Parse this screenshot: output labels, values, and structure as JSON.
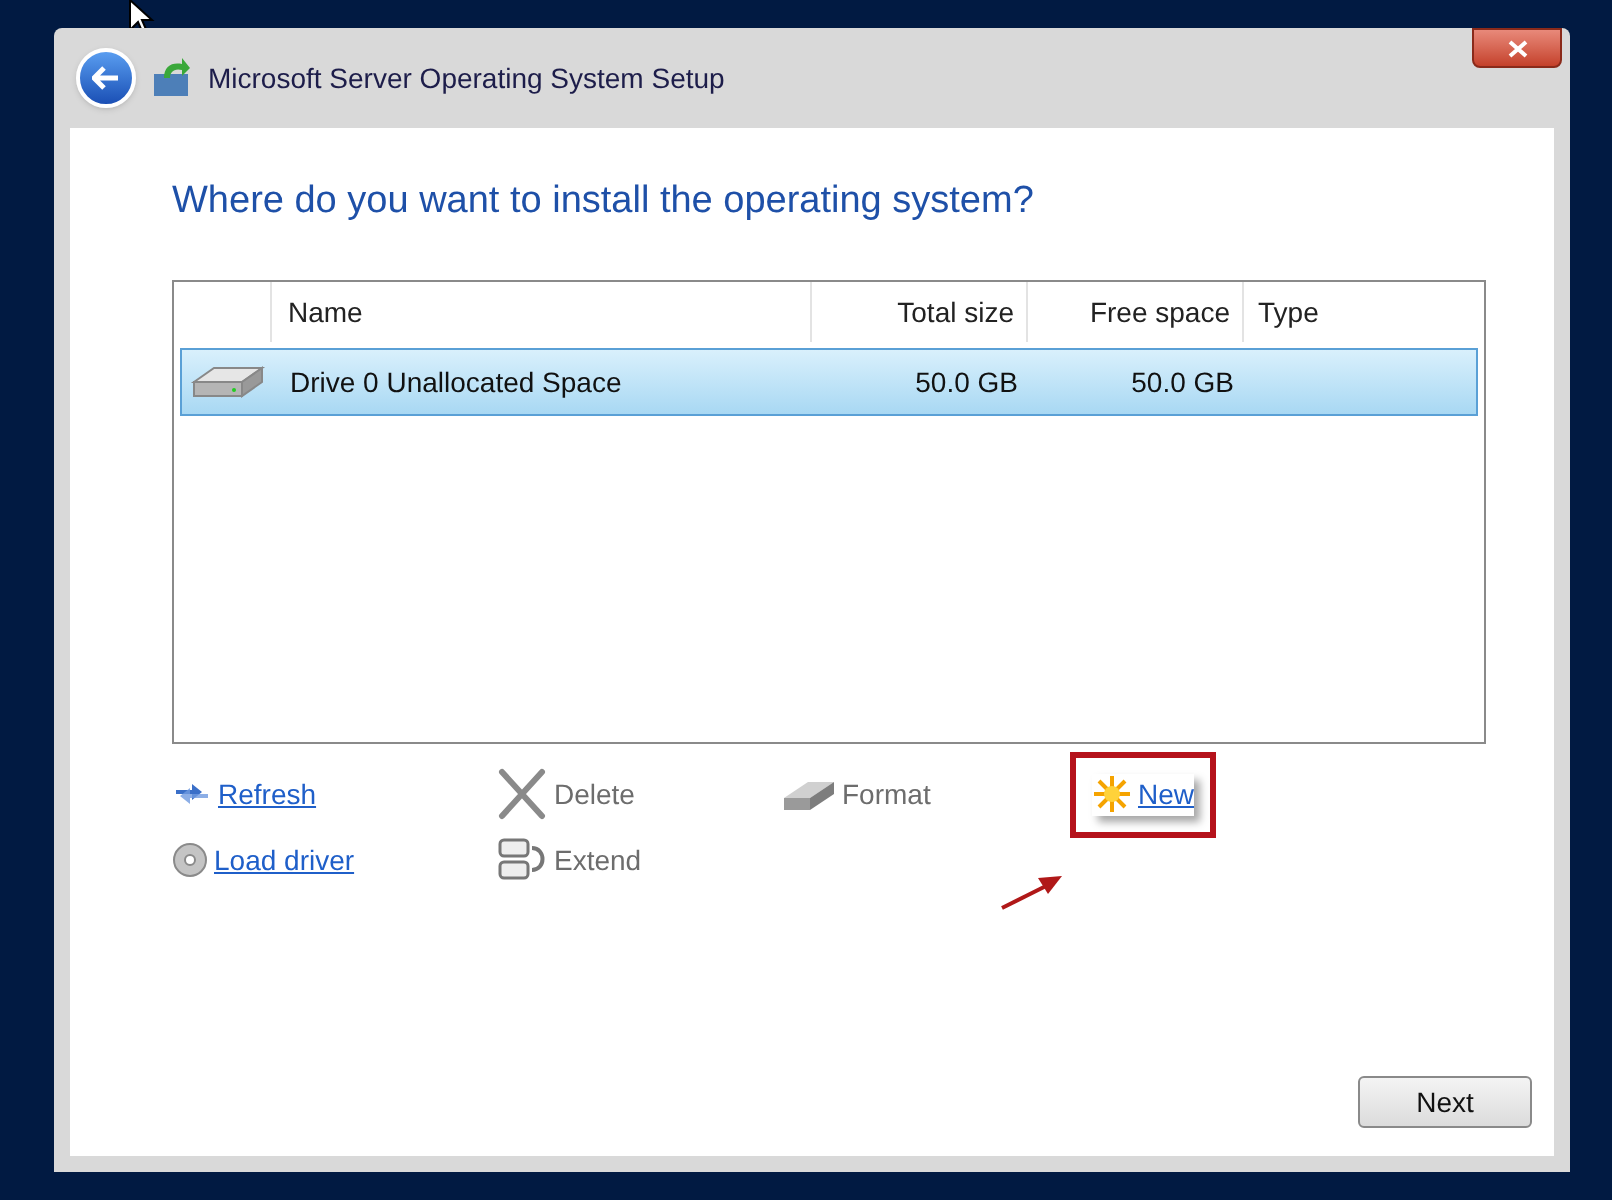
{
  "window": {
    "title": "Microsoft Server Operating System Setup"
  },
  "heading": "Where do you want to install the operating system?",
  "table": {
    "columns": [
      "Name",
      "Total size",
      "Free space",
      "Type"
    ],
    "rows": [
      {
        "name": "Drive 0 Unallocated Space",
        "total_size": "50.0 GB",
        "free_space": "50.0 GB",
        "selected": true
      }
    ]
  },
  "actions": [
    {
      "kind": "refresh",
      "label": "Refresh",
      "disabled": false,
      "highlighted": false
    },
    {
      "kind": "delete",
      "label": "Delete",
      "disabled": true,
      "highlighted": false
    },
    {
      "kind": "format",
      "label": "Format",
      "disabled": true,
      "highlighted": false
    },
    {
      "kind": "new",
      "label": "New",
      "disabled": false,
      "highlighted": true
    },
    {
      "kind": "load",
      "label": "Load driver",
      "disabled": false,
      "highlighted": false
    },
    {
      "kind": "extend",
      "label": "Extend",
      "disabled": true,
      "highlighted": false
    }
  ],
  "buttons": {
    "next": "Next"
  }
}
